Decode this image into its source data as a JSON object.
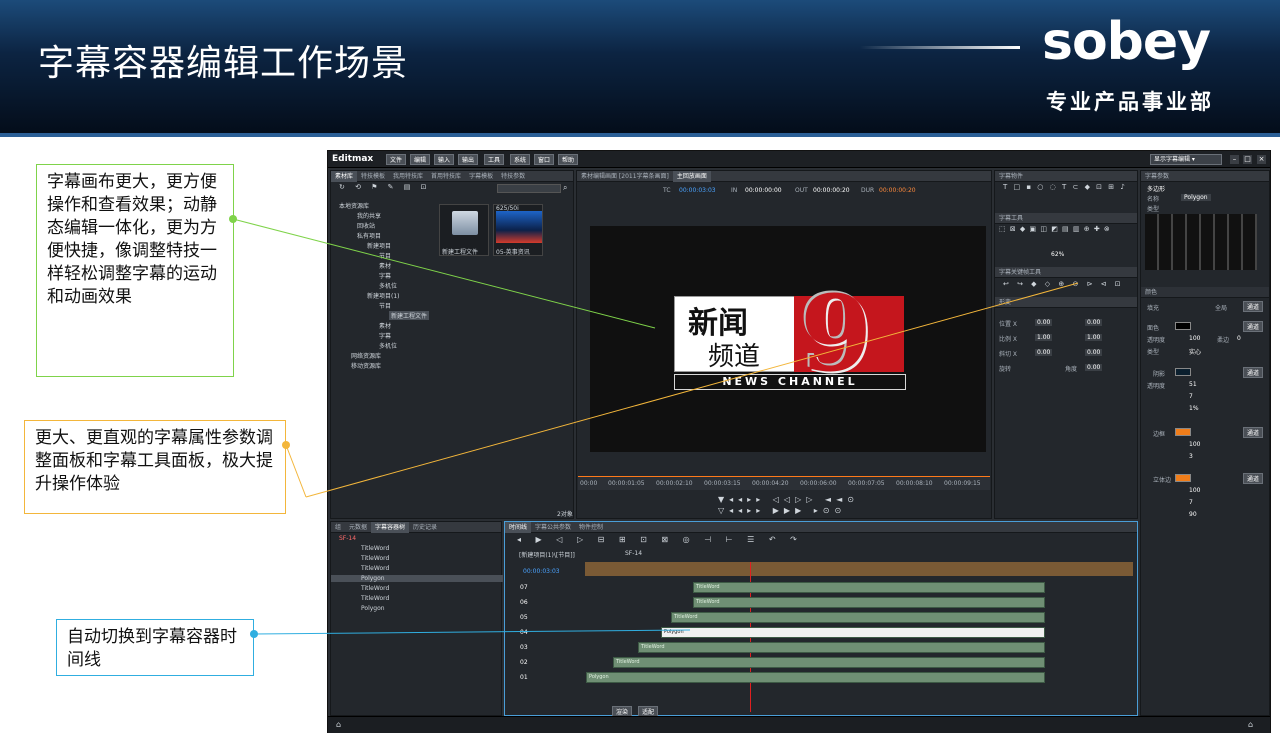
{
  "slide": {
    "title": "字幕容器编辑工作场景",
    "logo": "sobey",
    "logo_sub": "专业产品事业部"
  },
  "callouts": {
    "c1": "字幕画布更大，更方便操作和查看效果；动静态编辑一体化，更为方便快捷，像调整特技一样轻松调整字幕的运动和动画效果",
    "c2": "更大、更直观的字幕属性参数调整面板和字幕工具面板，极大提升操作体验",
    "c3": "自动切换到字幕容器时间线"
  },
  "app": {
    "brand": "Editmax",
    "menu": [
      "文件",
      "编辑",
      "输入",
      "输出",
      "工具",
      "系统",
      "窗口",
      "帮助"
    ],
    "workspace": "显示字幕编辑",
    "left_tabs": [
      "素材库",
      "特技模板",
      "我用特技库",
      "首用特技库",
      "字幕模板",
      "特技参数"
    ],
    "tree": [
      "本地资源库",
      "我的共享",
      "回收站",
      "私有项目",
      "新建项目",
      "节目",
      "素材",
      "字幕",
      "多机位",
      "新建项目(1)",
      "节目",
      "新建工程文件",
      "素材",
      "字幕",
      "多机位",
      "网络资源库",
      "移动资源库"
    ],
    "thumbs": [
      {
        "label": "新建工程文件",
        "badge": ""
      },
      {
        "label": "05-英事资讯",
        "badge": "625/50i"
      }
    ],
    "count": "2对象",
    "viewer_tabs": [
      "素材编辑画面 [2011字幕条画面]",
      "主回放画面"
    ],
    "tc": {
      "tc_label": "TC",
      "tc": "00:00:03:03",
      "in_label": "IN",
      "in": "00:00:00:00",
      "out_label": "OUT",
      "out": "00:00:00:20",
      "dur_label": "DUR",
      "dur": "00:00:00:20"
    },
    "news": {
      "line1": "新闻",
      "line2": "频道",
      "sub": "NEWS CHANNEL",
      "num": "9"
    },
    "ruler": [
      "00:00",
      "00:00:01:05",
      "00:00:02:10",
      "00:00:03:15",
      "00:00:04:20",
      "00:00:06:00",
      "00:00:07:05",
      "00:00:08:10",
      "00:00:09:15"
    ],
    "right_panels": {
      "tools_title": "字幕物件",
      "tool_title": "字幕工具",
      "zoom": "62%",
      "kf_title": "字幕关键帧工具",
      "transform_title": "形变",
      "props": [
        {
          "label": "位置 X",
          "v1": "0.00",
          "v2": "0.00"
        },
        {
          "label": "比例 X",
          "v1": "1.00",
          "v2": "1.00"
        },
        {
          "label": "斜切 X",
          "v1": "0.00",
          "v2": "0.00"
        },
        {
          "label": "旋转",
          "v1": "角度",
          "v2": "0.00"
        }
      ]
    },
    "prop_panel": {
      "title": "字幕参数",
      "type": "多边形",
      "name_label": "名称",
      "name": "Polygon",
      "type_label": "类型",
      "color_title": "颜色",
      "fill_label": "填充",
      "fill_val": "全局",
      "face": "面色",
      "trans": "透明度",
      "trans_v": "100",
      "soft": "柔边",
      "soft_v": "0",
      "kind": "类型",
      "kind_v": "实心",
      "shadow": "阴影",
      "shadow_trans": "51",
      "shadow_dist": "7",
      "shadow_mat": "1%",
      "edge": "边框",
      "edge_trans": "100",
      "edge_width": "3",
      "solid": "立体边",
      "solid_trans": "100",
      "solid_width": "7",
      "solid_angle": "90",
      "apply": "通道",
      "c_face": "#000000",
      "c_shadow": "#0b1f2e",
      "c_edge": "#f07d1a",
      "c_solid": "#f07d1a"
    },
    "bottom_tabs": [
      "组",
      "元数据",
      "字幕容器树",
      "历史记录"
    ],
    "layers": [
      "SF-14",
      "TitleWord",
      "TitleWord",
      "TitleWord",
      "Polygon",
      "TitleWord",
      "TitleWord",
      "Polygon"
    ],
    "tl_tabs": [
      "时间线",
      "字幕公共参数",
      "物件控制"
    ],
    "seq_tabs": [
      "[新建项目(1)\\[节目]]",
      "SF-14"
    ],
    "tl_tc": "00:00:03:03",
    "tracks": [
      "07",
      "06",
      "05",
      "04",
      "03",
      "02",
      "01"
    ],
    "clips": [
      "TitleWord",
      "TitleWord",
      "TitleWord",
      "Polygon",
      "TitleWord",
      "TitleWord",
      "Polygon"
    ],
    "tl_btns": [
      "渲染",
      "适配"
    ]
  }
}
